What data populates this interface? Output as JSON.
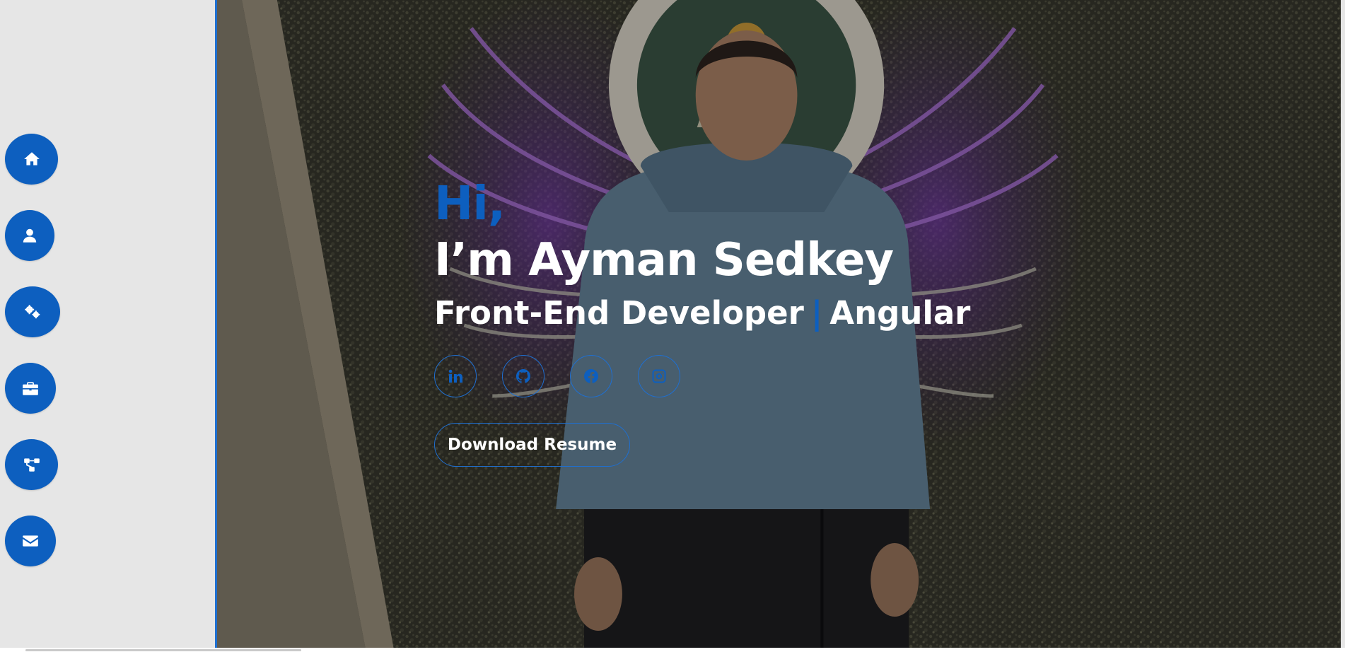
{
  "sidebar": {
    "items": [
      {
        "icon": "home-icon",
        "name": "nav-home-button"
      },
      {
        "icon": "user-icon",
        "name": "nav-about-button"
      },
      {
        "icon": "gears-icon",
        "name": "nav-skills-button"
      },
      {
        "icon": "briefcase-icon",
        "name": "nav-experience-button"
      },
      {
        "icon": "projects-icon",
        "name": "nav-projects-button"
      },
      {
        "icon": "envelope-icon",
        "name": "nav-contact-button"
      }
    ]
  },
  "hero": {
    "greeting": "Hi,",
    "name": "I’m Ayman Sedkey",
    "role_primary": "Front-End Developer",
    "role_separator": "|",
    "role_secondary": "Angular",
    "socials": [
      {
        "icon": "linkedin-icon"
      },
      {
        "icon": "github-icon"
      },
      {
        "icon": "facebook-icon"
      },
      {
        "icon": "instagram-icon"
      }
    ],
    "download_label": "Download Resume"
  },
  "colors": {
    "accent": "#0d5fbf",
    "sidebar_bg": "#e6e6e6",
    "text_light": "#ffffff"
  }
}
